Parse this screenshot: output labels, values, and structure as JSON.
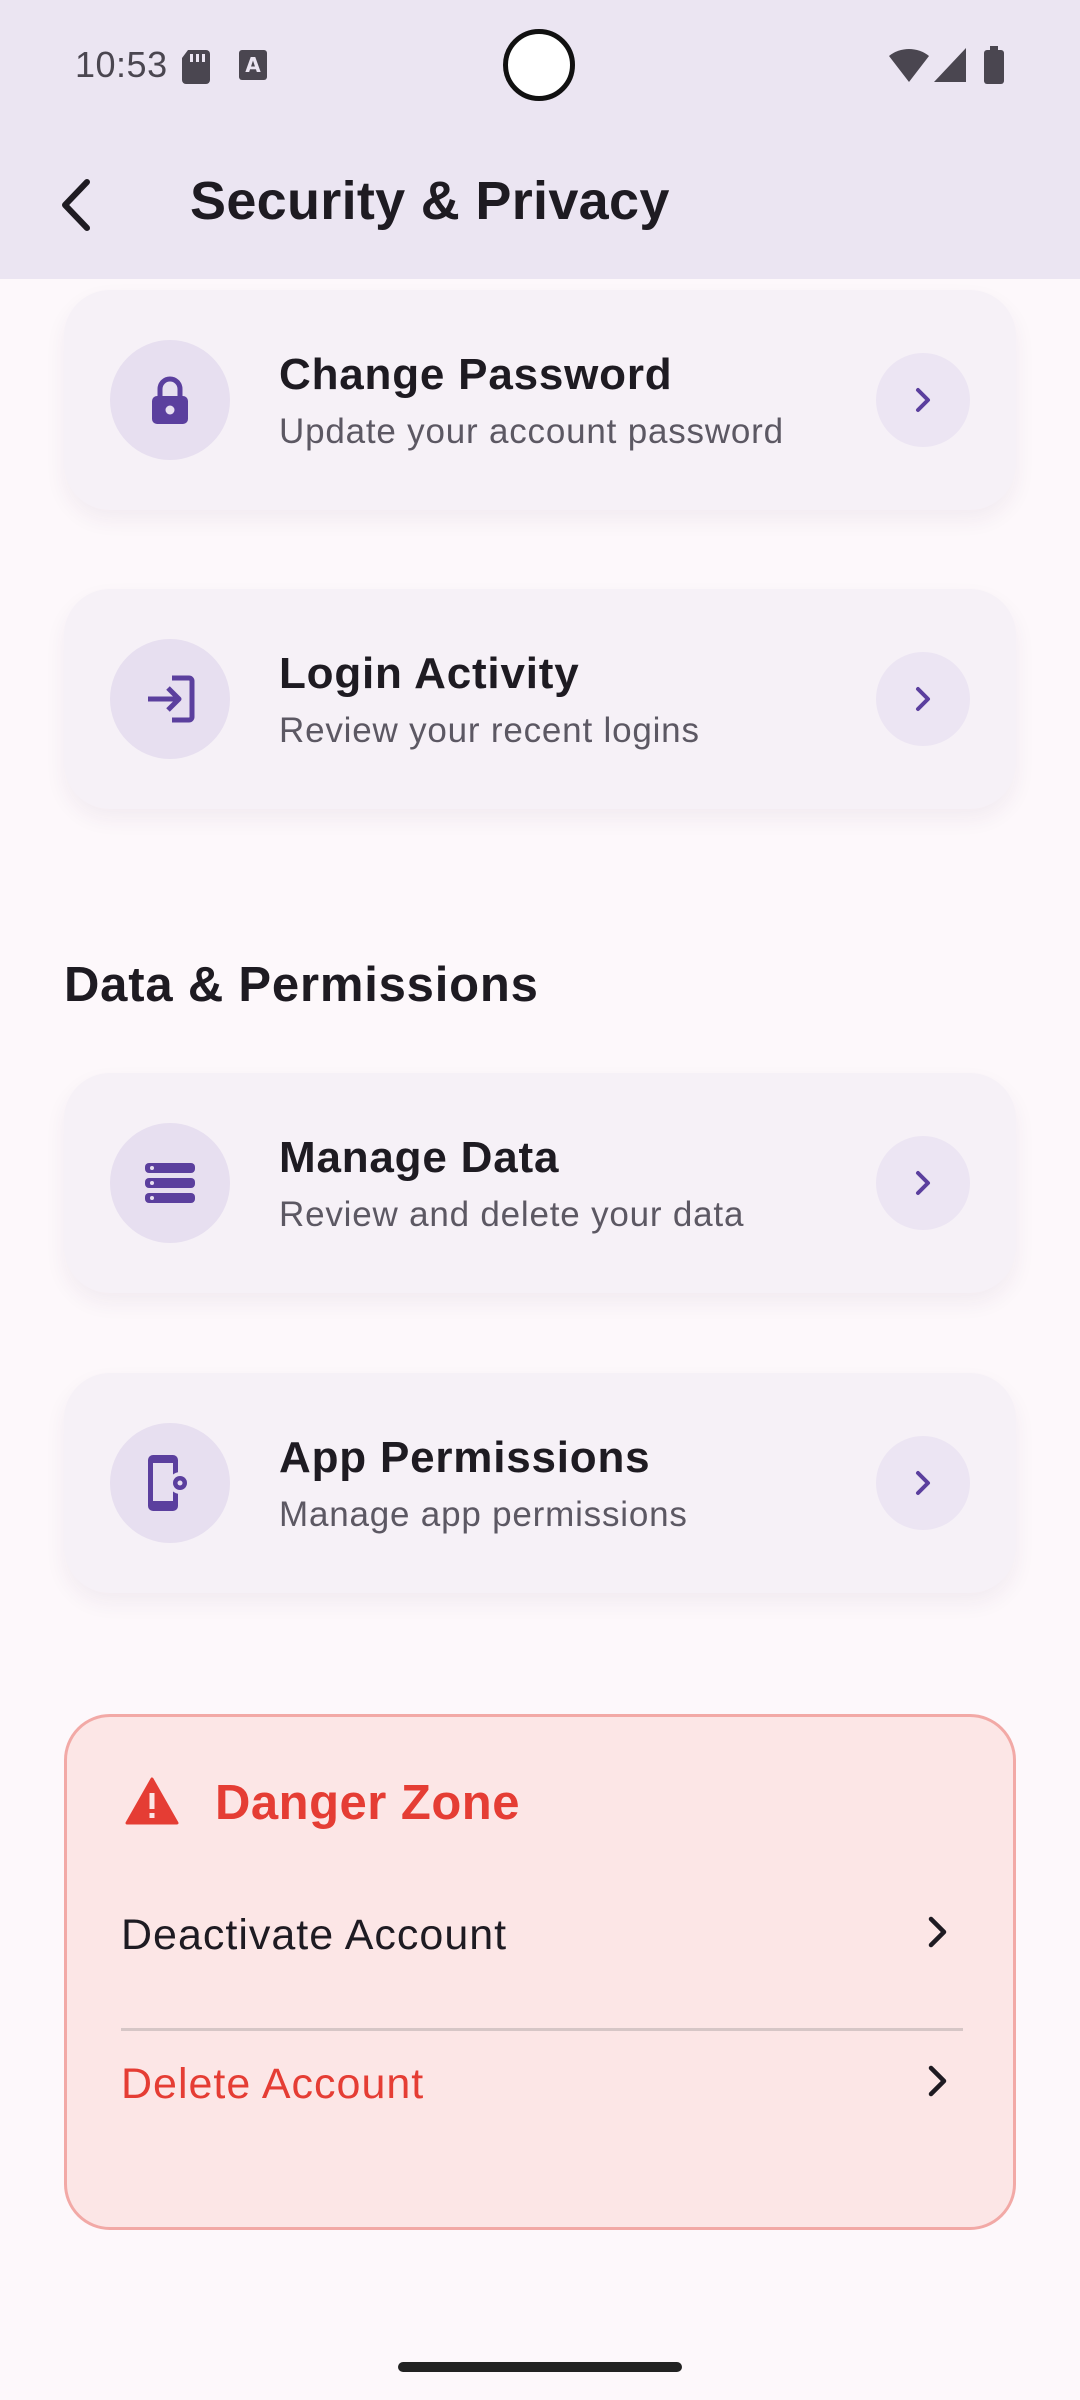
{
  "status_bar": {
    "time": "10:53",
    "icons": [
      "sd-card-icon",
      "a-icon",
      "wifi-icon",
      "signal-icon",
      "battery-icon"
    ]
  },
  "header": {
    "title": "Security & Privacy",
    "back_icon": "back-arrow-icon"
  },
  "account_items": [
    {
      "title": "Change Password",
      "subtitle": "Update your account password",
      "icon": "lock-icon"
    },
    {
      "title": "Login Activity",
      "subtitle": "Review your recent logins",
      "icon": "login-icon"
    }
  ],
  "data_section": {
    "heading": "Data & Permissions",
    "items": [
      {
        "title": "Manage Data",
        "subtitle": "Review and delete your data",
        "icon": "storage-icon"
      },
      {
        "title": "App Permissions",
        "subtitle": "Manage app permissions",
        "icon": "phone-settings-icon"
      }
    ]
  },
  "danger_zone": {
    "title": "Danger Zone",
    "icon": "warning-icon",
    "deactivate_label": "Deactivate Account",
    "delete_label": "Delete Account"
  },
  "colors": {
    "accent": "#5b3f9e",
    "danger": "#e53d34",
    "header_bg": "#ebe5f2",
    "page_bg": "#fdf8fb"
  }
}
